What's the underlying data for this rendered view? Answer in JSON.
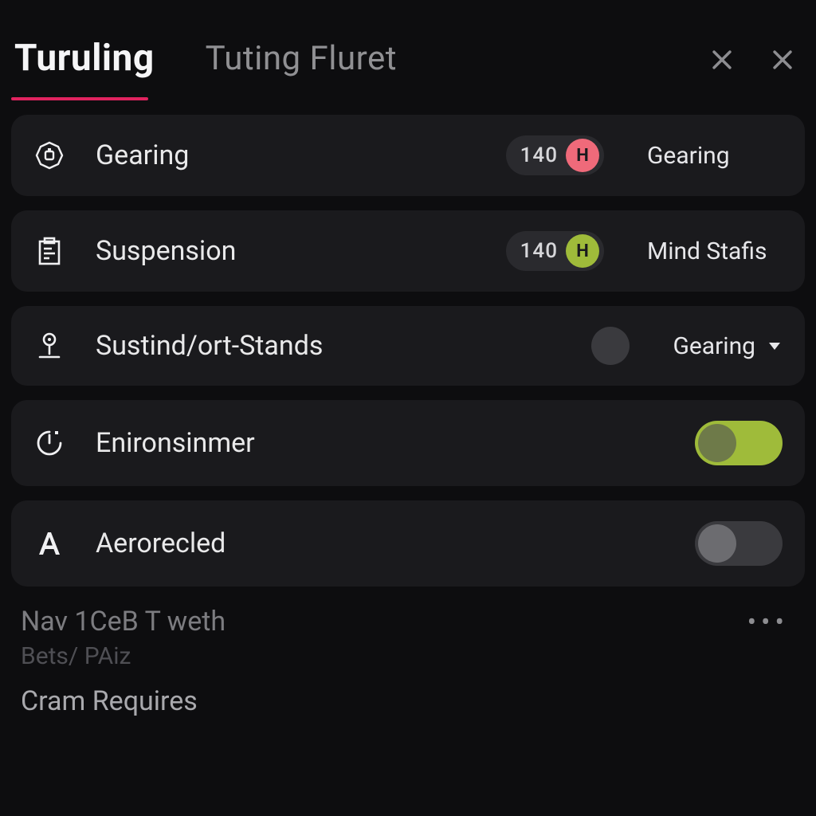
{
  "tabs": {
    "active": "Turuling",
    "inactive": "Tuting Fluret"
  },
  "rows": {
    "gearing": {
      "label": "Gearing",
      "value": "140",
      "chip": "H",
      "right": "Gearing"
    },
    "suspension": {
      "label": "Suspension",
      "value": "140",
      "chip": "H",
      "right": "Mind Stafis"
    },
    "sustind": {
      "label": "Sustind/ort-Stands",
      "right": "Gearing"
    },
    "enironsinmer": {
      "label": "Enironsinmer"
    },
    "aerorecled": {
      "label": "Aerorecled"
    }
  },
  "footer": {
    "line1": "Nav 1CeB T weth",
    "line2": "Bets/ PAiz",
    "line3": "Cram Requires",
    "more": "•••"
  },
  "colors": {
    "accent": "#e0235f",
    "pink": "#ef6a7a",
    "green": "#9fbb3a"
  }
}
